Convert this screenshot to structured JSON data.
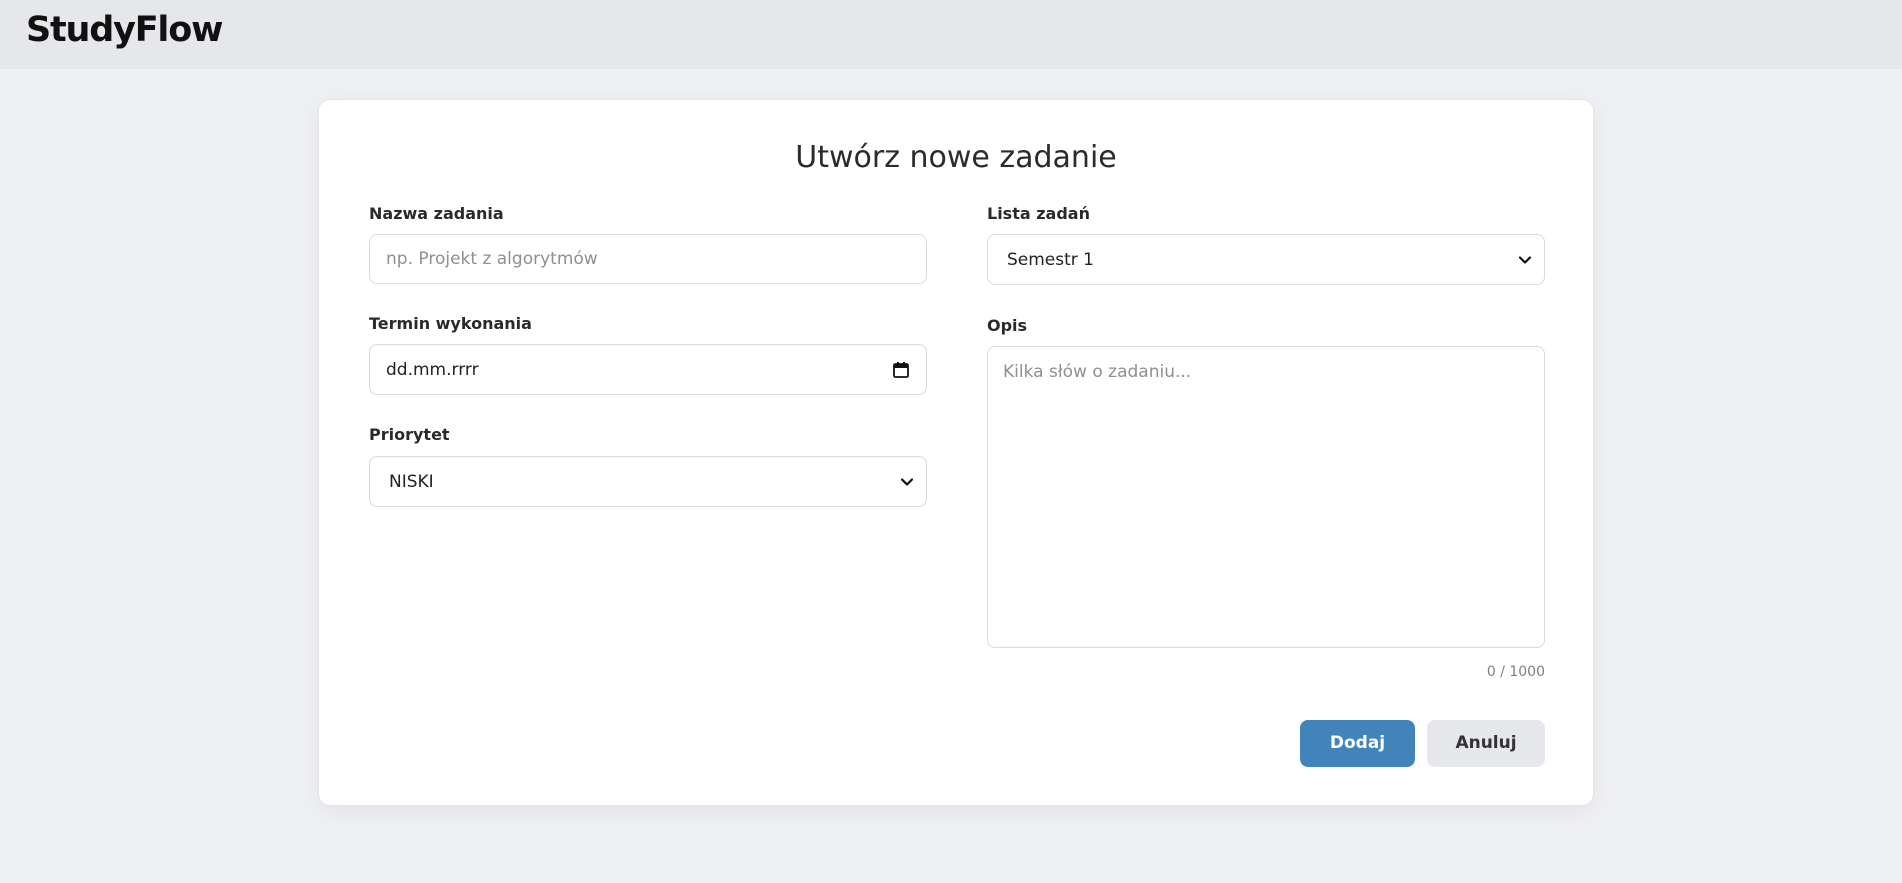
{
  "app": {
    "logo": "StudyFlow"
  },
  "form": {
    "title": "Utwórz nowe zadanie",
    "task_name": {
      "label": "Nazwa zadania",
      "placeholder": "np. Projekt z algorytmów",
      "value": ""
    },
    "due_date": {
      "label": "Termin wykonania",
      "value": "dd.mm.rrrr"
    },
    "priority": {
      "label": "Priorytet",
      "selected": "NISKI"
    },
    "task_list": {
      "label": "Lista zadań",
      "selected": "Semestr 1"
    },
    "description": {
      "label": "Opis",
      "placeholder": "Kilka słów o zadaniu...",
      "counter": "0 / 1000"
    },
    "buttons": {
      "add": "Dodaj",
      "cancel": "Anuluj"
    }
  },
  "colors": {
    "primary": "#4184bb",
    "background": "#eff0f3",
    "topbar": "#e6e7ea"
  },
  "icons": {
    "date": "calendar-icon",
    "select": "chevron-down-icon"
  }
}
